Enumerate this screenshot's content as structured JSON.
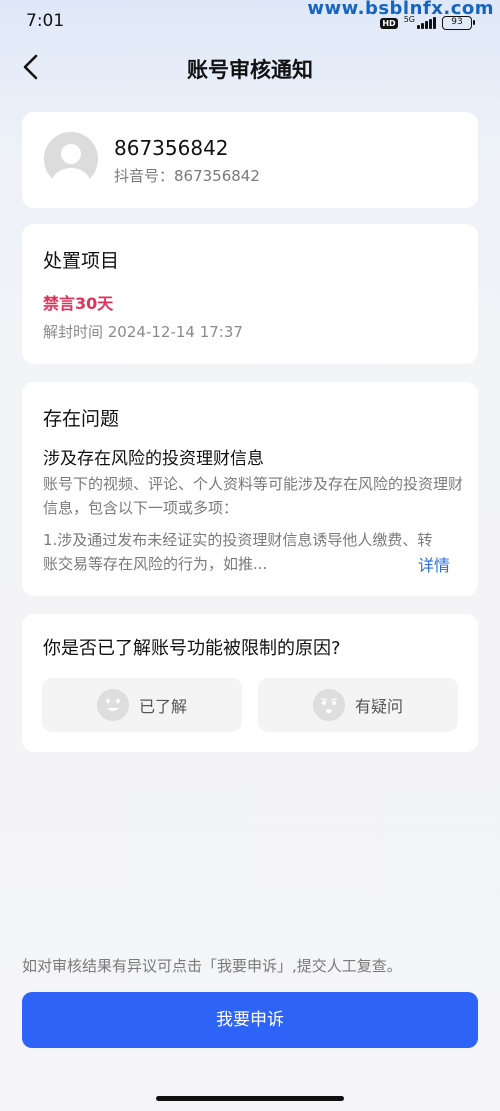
{
  "status_bar": {
    "time": "7:01",
    "network": "5G",
    "hd_badge": "HD",
    "battery": "93",
    "watermark": "www.bsblnfx.com"
  },
  "header": {
    "back_icon": "chevron-left-icon",
    "title": "账号审核通知"
  },
  "profile": {
    "name": "867356842",
    "douyin_id": "抖音号：867356842"
  },
  "disposal": {
    "title": "处置项目",
    "penalty": "禁言30天",
    "unban_time": "解封时间 2024-12-14 17:37"
  },
  "issue": {
    "title": "存在问题",
    "subtitle": "涉及存在风险的投资理财信息",
    "description": "账号下的视频、评论、个人资料等可能涉及存在风险的投资理财信息，包含以下一项或多项：",
    "detail": "1.涉及通过发布未经证实的投资理财信息诱导他人缴费、转账交易等存在风险的行为，如推...",
    "detail_link": "详情"
  },
  "feedback": {
    "question": "你是否已了解账号功能被限制的原因?",
    "options": [
      {
        "label": "已了解",
        "icon": "smile-heart-eyes-icon"
      },
      {
        "label": "有疑问",
        "icon": "confused-face-icon"
      }
    ]
  },
  "footer": {
    "hint": "如对审核结果有异议可点击「我要申诉」,提交人工复查。",
    "appeal_button": "我要申诉"
  },
  "colors": {
    "accent": "#2d63f6",
    "penalty": "#e0335b",
    "link": "#2f6ed8"
  }
}
